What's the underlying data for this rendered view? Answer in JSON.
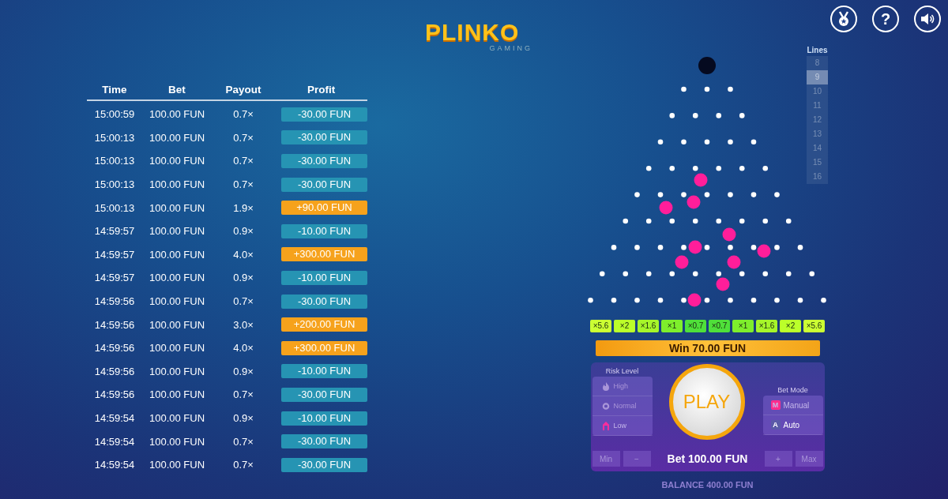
{
  "logo": {
    "title": "PLINKO",
    "subtitle": "GAMING"
  },
  "header_buttons": [
    {
      "kind": "medal"
    },
    {
      "kind": "help",
      "label": "?"
    },
    {
      "kind": "sound"
    }
  ],
  "history": {
    "columns": [
      "Time",
      "Bet",
      "Payout",
      "Profit"
    ],
    "rows": [
      {
        "time": "15:00:59",
        "bet": "100.00 FUN",
        "payout": "0.7×",
        "profit": "-30.00 FUN",
        "kind": "loss"
      },
      {
        "time": "15:00:13",
        "bet": "100.00 FUN",
        "payout": "0.7×",
        "profit": "-30.00 FUN",
        "kind": "loss"
      },
      {
        "time": "15:00:13",
        "bet": "100.00 FUN",
        "payout": "0.7×",
        "profit": "-30.00 FUN",
        "kind": "loss"
      },
      {
        "time": "15:00:13",
        "bet": "100.00 FUN",
        "payout": "0.7×",
        "profit": "-30.00 FUN",
        "kind": "loss"
      },
      {
        "time": "15:00:13",
        "bet": "100.00 FUN",
        "payout": "1.9×",
        "profit": "+90.00 FUN",
        "kind": "win"
      },
      {
        "time": "14:59:57",
        "bet": "100.00 FUN",
        "payout": "0.9×",
        "profit": "-10.00 FUN",
        "kind": "loss"
      },
      {
        "time": "14:59:57",
        "bet": "100.00 FUN",
        "payout": "4.0×",
        "profit": "+300.00 FUN",
        "kind": "win"
      },
      {
        "time": "14:59:57",
        "bet": "100.00 FUN",
        "payout": "0.9×",
        "profit": "-10.00 FUN",
        "kind": "loss"
      },
      {
        "time": "14:59:56",
        "bet": "100.00 FUN",
        "payout": "0.7×",
        "profit": "-30.00 FUN",
        "kind": "loss"
      },
      {
        "time": "14:59:56",
        "bet": "100.00 FUN",
        "payout": "3.0×",
        "profit": "+200.00 FUN",
        "kind": "win"
      },
      {
        "time": "14:59:56",
        "bet": "100.00 FUN",
        "payout": "4.0×",
        "profit": "+300.00 FUN",
        "kind": "win"
      },
      {
        "time": "14:59:56",
        "bet": "100.00 FUN",
        "payout": "0.9×",
        "profit": "-10.00 FUN",
        "kind": "loss"
      },
      {
        "time": "14:59:56",
        "bet": "100.00 FUN",
        "payout": "0.7×",
        "profit": "-30.00 FUN",
        "kind": "loss"
      },
      {
        "time": "14:59:54",
        "bet": "100.00 FUN",
        "payout": "0.9×",
        "profit": "-10.00 FUN",
        "kind": "loss"
      },
      {
        "time": "14:59:54",
        "bet": "100.00 FUN",
        "payout": "0.7×",
        "profit": "-30.00 FUN",
        "kind": "loss"
      },
      {
        "time": "14:59:54",
        "bet": "100.00 FUN",
        "payout": "0.7×",
        "profit": "-30.00 FUN",
        "kind": "loss"
      }
    ]
  },
  "lines": {
    "label": "Lines",
    "options": [
      {
        "label": "8",
        "selected": false
      },
      {
        "label": "9",
        "selected": true
      },
      {
        "label": "10",
        "selected": false
      },
      {
        "label": "11",
        "selected": false
      },
      {
        "label": "12",
        "selected": false
      },
      {
        "label": "13",
        "selected": false
      },
      {
        "label": "14",
        "selected": false
      },
      {
        "label": "15",
        "selected": false
      },
      {
        "label": "16",
        "selected": false
      }
    ]
  },
  "multipliers": [
    {
      "label": "×5.6",
      "color": "#ccff33"
    },
    {
      "label": "×2",
      "color": "#bbff2a"
    },
    {
      "label": "×1.6",
      "color": "#a6f52a"
    },
    {
      "label": "×1",
      "color": "#7eee2c"
    },
    {
      "label": "×0.7",
      "color": "#4fe03a"
    },
    {
      "label": "×0.7",
      "color": "#4fe03a"
    },
    {
      "label": "×1",
      "color": "#7eee2c"
    },
    {
      "label": "×1.6",
      "color": "#a6f52a"
    },
    {
      "label": "×2",
      "color": "#bbff2a"
    },
    {
      "label": "×5.6",
      "color": "#ccff33"
    }
  ],
  "win_banner": "Win 70.00 FUN",
  "risk": {
    "label": "Risk Level",
    "options": [
      {
        "label": "High",
        "kind": "high",
        "selected": false
      },
      {
        "label": "Normal",
        "kind": "normal",
        "selected": false
      },
      {
        "label": "Low",
        "kind": "low",
        "selected": true
      }
    ]
  },
  "play_button": "PLAY",
  "bet_mode": {
    "label": "Bet Mode",
    "options": [
      {
        "label": "Manual",
        "key": "M",
        "selected": true
      },
      {
        "label": "Auto",
        "key": "A",
        "selected": false
      }
    ]
  },
  "bet": {
    "min": "Min",
    "minus": "−",
    "amount": "Bet 100.00 FUN",
    "plus": "+",
    "max": "Max"
  },
  "balance": "BALANCE 400.00 FUN"
}
